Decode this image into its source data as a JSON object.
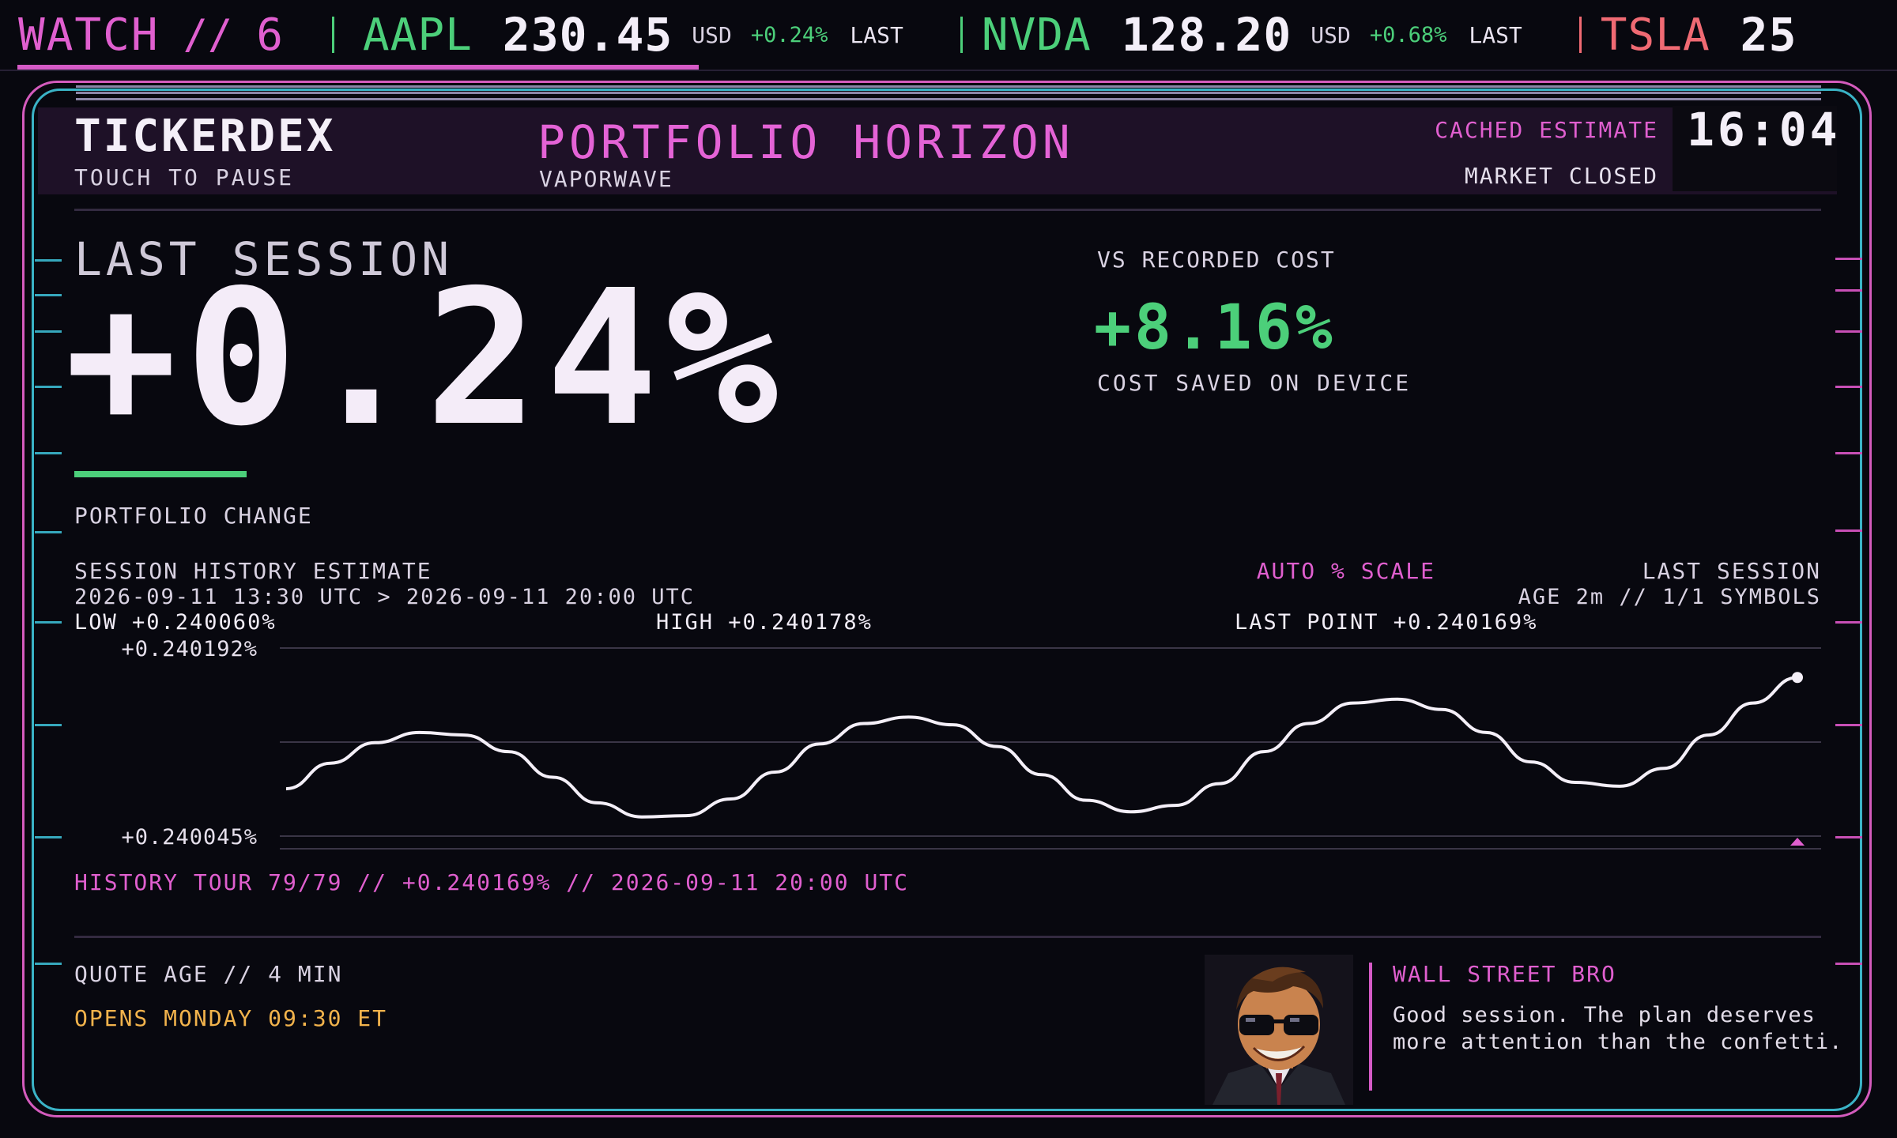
{
  "ticker": {
    "watch_label": "WATCH",
    "watch_sep": "//",
    "watch_count": "6",
    "items": [
      {
        "symbol": "AAPL",
        "price": "230.45",
        "currency": "USD",
        "change": "+0.24%",
        "status": "LAST"
      },
      {
        "symbol": "NVDA",
        "price": "128.20",
        "currency": "USD",
        "change": "+0.68%",
        "status": "LAST"
      },
      {
        "symbol": "TSLA",
        "price": "25",
        "currency": "",
        "change": "",
        "status": ""
      }
    ],
    "colors": {
      "watch": "#e05fcf",
      "up": "#4ccf7a",
      "tsla": "#f06a73",
      "separator": "#e05fcf"
    }
  },
  "header": {
    "brand": "TICKERDEX",
    "brand_hint": "TOUCH TO PAUSE",
    "title": "PORTFOLIO HORIZON",
    "theme": "VAPORWAVE",
    "data_status": "CACHED ESTIMATE",
    "market_status": "MARKET CLOSED",
    "clock": "16:04"
  },
  "hero": {
    "label": "LAST SESSION",
    "value": "+0.24%",
    "caption": "PORTFOLIO CHANGE",
    "compare_label": "VS RECORDED COST",
    "compare_value": "+8.16%",
    "compare_caption": "COST SAVED ON DEVICE"
  },
  "history": {
    "title": "SESSION HISTORY ESTIMATE",
    "range": "2026-09-11 13:30 UTC > 2026-09-11 20:00 UTC",
    "scale": "AUTO % SCALE",
    "session_label": "LAST SESSION",
    "age": "AGE 2m // 1/1 SYMBOLS",
    "low": "LOW +0.240060%",
    "high": "HIGH +0.240178%",
    "last_point": "LAST POINT +0.240169%",
    "tour": "HISTORY TOUR 79/79 // +0.240169% // 2026-09-11 20:00 UTC"
  },
  "chart_data": {
    "type": "line",
    "title": "",
    "xlabel": "",
    "ylabel": "",
    "ylim": [
      0.240045,
      0.240192
    ],
    "y_tick_labels": [
      "+0.240192%",
      "+0.240045%"
    ],
    "grid": true,
    "series": [
      {
        "values": [
          0.240082,
          0.240102,
          0.240118,
          0.240126,
          0.240124,
          0.240111,
          0.240091,
          0.240071,
          0.24006,
          0.240061,
          0.240074,
          0.240095,
          0.240117,
          0.240133,
          0.240138,
          0.240132,
          0.240115,
          0.240093,
          0.240073,
          0.240064,
          0.240069,
          0.240086,
          0.240111,
          0.240133,
          0.240149,
          0.240152,
          0.240144,
          0.240126,
          0.240103,
          0.240087,
          0.240084,
          0.240098,
          0.240124,
          0.240149,
          0.240169
        ]
      }
    ]
  },
  "footer": {
    "quote_age": "QUOTE AGE // 4 MIN",
    "opens": "OPENS MONDAY 09:30 ET",
    "persona_name": "WALL STREET BRO",
    "persona_quote": "Good session. The plan deserves more attention than the confetti."
  }
}
